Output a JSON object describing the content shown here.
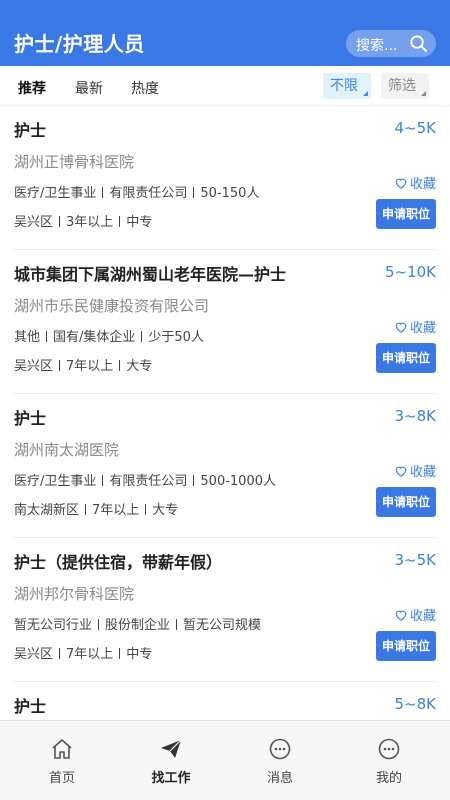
{
  "header": {
    "title": "护士/护理人员",
    "search_placeholder": "搜索..."
  },
  "filters": {
    "tabs": [
      "推荐",
      "最新",
      "热度"
    ],
    "active_tab": "推荐",
    "nolimit_label": "不限",
    "filter_label": "筛选"
  },
  "jobs": [
    {
      "title": "护士",
      "salary": "4~5K",
      "company": "湖州正博骨科医院",
      "industry": "医疗/卫生事业",
      "ownership": "有限责任公司",
      "size": "50-150人",
      "district": "吴兴区",
      "experience": "3年以上",
      "education": "中专",
      "fav_label": "收藏",
      "apply_label": "申请职位"
    },
    {
      "title": "城市集团下属湖州蜀山老年医院—护士",
      "salary": "5~10K",
      "company": "湖州市乐民健康投资有限公司",
      "industry": "其他",
      "ownership": "国有/集体企业",
      "size": "少于50人",
      "district": "吴兴区",
      "experience": "7年以上",
      "education": "大专",
      "fav_label": "收藏",
      "apply_label": "申请职位"
    },
    {
      "title": "护士",
      "salary": "3~8K",
      "company": "湖州南太湖医院",
      "industry": "医疗/卫生事业",
      "ownership": "有限责任公司",
      "size": "500-1000人",
      "district": "南太湖新区",
      "experience": "7年以上",
      "education": "大专",
      "fav_label": "收藏",
      "apply_label": "申请职位"
    },
    {
      "title": "护士（提供住宿，带薪年假）",
      "salary": "3~5K",
      "company": "湖州邦尔骨科医院",
      "industry": "暂无公司行业",
      "ownership": "股份制企业",
      "size": "暂无公司规模",
      "district": "吴兴区",
      "experience": "7年以上",
      "education": "中专",
      "fav_label": "收藏",
      "apply_label": "申请职位"
    },
    {
      "title": "护士",
      "salary": "5~8K"
    }
  ],
  "tabbar": [
    {
      "label": "首页",
      "icon": "home-icon"
    },
    {
      "label": "找工作",
      "icon": "paper-plane-icon",
      "active": true
    },
    {
      "label": "消息",
      "icon": "chat-bubble-icon"
    },
    {
      "label": "我的",
      "icon": "more-dots-icon"
    }
  ],
  "colors": {
    "primary": "#3a78e6",
    "salary": "#3b82e0"
  }
}
